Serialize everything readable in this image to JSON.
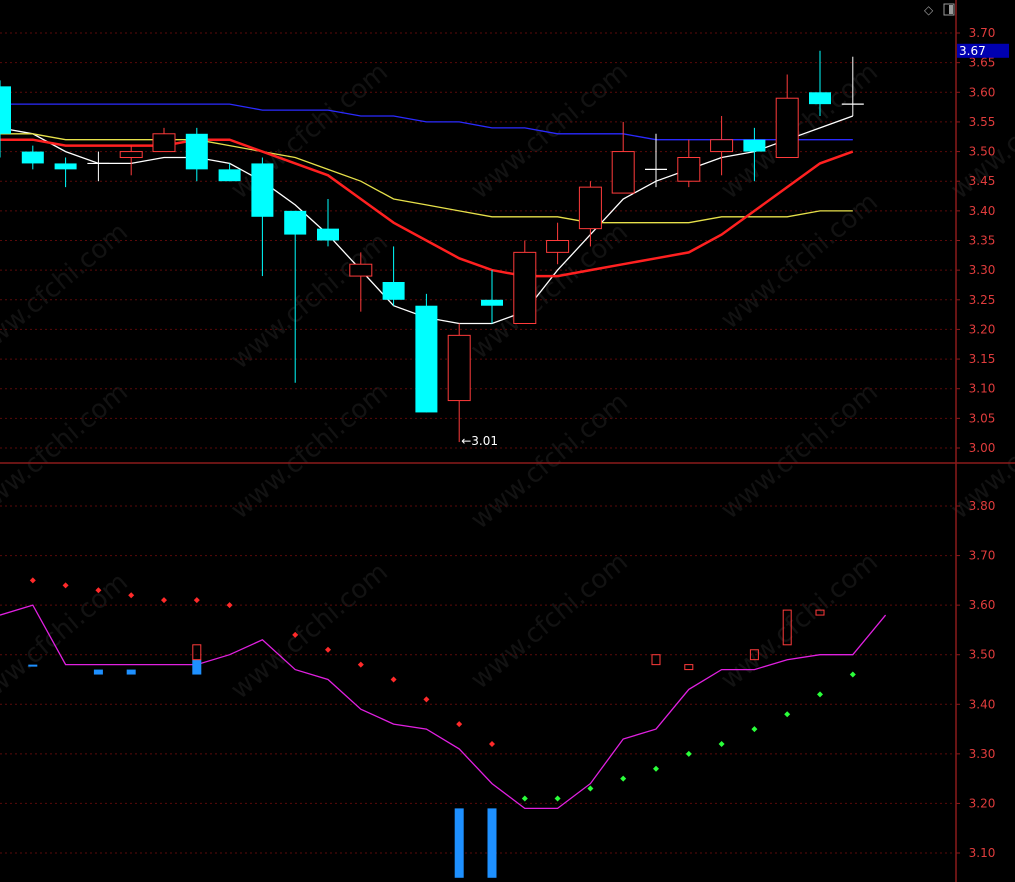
{
  "toolbar": {
    "diamond_icon": "diamond-icon",
    "panel_icon": "panel-toggle-icon"
  },
  "watermark": "www.cfchi.com",
  "colors": {
    "bg": "#000000",
    "grid": "#5a0a0a",
    "axis": "#8a1a1a",
    "tick": "#e03c3c",
    "up": "#ff3b3b",
    "down": "#00ffff",
    "doji": "#ffffff",
    "ma_white": "#ffffff",
    "ma_yellow": "#e6e04a",
    "ma_red": "#ff2020",
    "ma_blue": "#2a2aff",
    "sar_red": "#ff2a2a",
    "sar_green": "#2aff3a",
    "mid_line": "#e020e0",
    "vol_blue": "#1e90ff",
    "box_red": "#ff3b3b",
    "last_box_bg": "#0000b0"
  },
  "chart_data": [
    {
      "type": "candlestick",
      "panel": "price",
      "ylim": [
        2.97,
        3.72
      ],
      "y_ticks": [
        "3.70",
        "3.65",
        "3.60",
        "3.55",
        "3.50",
        "3.45",
        "3.40",
        "3.35",
        "3.30",
        "3.25",
        "3.20",
        "3.15",
        "3.10",
        "3.05",
        "3.00"
      ],
      "last_price_label": "3.67",
      "low_annotation": "3.01",
      "candles": [
        {
          "o": 3.61,
          "h": 3.62,
          "l": 3.49,
          "c": 3.53
        },
        {
          "o": 3.5,
          "h": 3.51,
          "l": 3.47,
          "c": 3.48
        },
        {
          "o": 3.48,
          "h": 3.49,
          "l": 3.44,
          "c": 3.47
        },
        {
          "o": 3.48,
          "h": 3.5,
          "l": 3.45,
          "c": 3.48
        },
        {
          "o": 3.49,
          "h": 3.51,
          "l": 3.46,
          "c": 3.5
        },
        {
          "o": 3.5,
          "h": 3.54,
          "l": 3.5,
          "c": 3.53
        },
        {
          "o": 3.53,
          "h": 3.54,
          "l": 3.45,
          "c": 3.47
        },
        {
          "o": 3.47,
          "h": 3.48,
          "l": 3.45,
          "c": 3.45
        },
        {
          "o": 3.48,
          "h": 3.49,
          "l": 3.29,
          "c": 3.39
        },
        {
          "o": 3.4,
          "h": 3.4,
          "l": 3.11,
          "c": 3.36
        },
        {
          "o": 3.37,
          "h": 3.42,
          "l": 3.34,
          "c": 3.35
        },
        {
          "o": 3.29,
          "h": 3.33,
          "l": 3.23,
          "c": 3.31
        },
        {
          "o": 3.28,
          "h": 3.34,
          "l": 3.24,
          "c": 3.25
        },
        {
          "o": 3.24,
          "h": 3.26,
          "l": 3.06,
          "c": 3.06
        },
        {
          "o": 3.08,
          "h": 3.21,
          "l": 3.01,
          "c": 3.19
        },
        {
          "o": 3.25,
          "h": 3.3,
          "l": 3.21,
          "c": 3.24
        },
        {
          "o": 3.21,
          "h": 3.35,
          "l": 3.21,
          "c": 3.33
        },
        {
          "o": 3.33,
          "h": 3.38,
          "l": 3.31,
          "c": 3.35
        },
        {
          "o": 3.37,
          "h": 3.45,
          "l": 3.34,
          "c": 3.44
        },
        {
          "o": 3.43,
          "h": 3.55,
          "l": 3.43,
          "c": 3.5
        },
        {
          "o": 3.47,
          "h": 3.53,
          "l": 3.44,
          "c": 3.47
        },
        {
          "o": 3.45,
          "h": 3.52,
          "l": 3.44,
          "c": 3.49
        },
        {
          "o": 3.5,
          "h": 3.56,
          "l": 3.46,
          "c": 3.52
        },
        {
          "o": 3.52,
          "h": 3.54,
          "l": 3.45,
          "c": 3.5
        },
        {
          "o": 3.49,
          "h": 3.63,
          "l": 3.49,
          "c": 3.59
        },
        {
          "o": 3.6,
          "h": 3.67,
          "l": 3.56,
          "c": 3.58
        },
        {
          "o": 3.58,
          "h": 3.66,
          "l": 3.56,
          "c": 3.58
        }
      ],
      "series": [
        {
          "color_key": "ma_white",
          "values": [
            3.54,
            3.53,
            3.5,
            3.48,
            3.48,
            3.49,
            3.49,
            3.48,
            3.45,
            3.41,
            3.36,
            3.3,
            3.24,
            3.22,
            3.21,
            3.21,
            3.23,
            3.3,
            3.36,
            3.42,
            3.45,
            3.47,
            3.49,
            3.5,
            3.52,
            3.54,
            3.56
          ]
        },
        {
          "color_key": "ma_yellow",
          "values": [
            3.53,
            3.53,
            3.52,
            3.52,
            3.52,
            3.52,
            3.52,
            3.51,
            3.5,
            3.49,
            3.47,
            3.45,
            3.42,
            3.41,
            3.4,
            3.39,
            3.39,
            3.39,
            3.38,
            3.38,
            3.38,
            3.38,
            3.39,
            3.39,
            3.39,
            3.4,
            3.4
          ]
        },
        {
          "color_key": "ma_red",
          "values": [
            3.52,
            3.52,
            3.51,
            3.51,
            3.51,
            3.51,
            3.52,
            3.52,
            3.5,
            3.48,
            3.46,
            3.42,
            3.38,
            3.35,
            3.32,
            3.3,
            3.29,
            3.29,
            3.3,
            3.31,
            3.32,
            3.33,
            3.36,
            3.4,
            3.44,
            3.48,
            3.5
          ]
        },
        {
          "color_key": "ma_blue",
          "values": [
            3.58,
            3.58,
            3.58,
            3.58,
            3.58,
            3.58,
            3.58,
            3.58,
            3.57,
            3.57,
            3.57,
            3.56,
            3.56,
            3.55,
            3.55,
            3.54,
            3.54,
            3.53,
            3.53,
            3.53,
            3.52,
            3.52,
            3.52,
            3.52,
            3.52,
            3.52,
            3.52
          ]
        }
      ]
    },
    {
      "type": "indicator",
      "panel": "lower",
      "ylim": [
        3.07,
        3.88
      ],
      "y_ticks": [
        "3.80",
        "3.70",
        "3.60",
        "3.50",
        "3.40",
        "3.30",
        "3.20",
        "3.10"
      ],
      "mid_line": [
        3.58,
        3.6,
        3.48,
        3.48,
        3.48,
        3.48,
        3.48,
        3.5,
        3.53,
        3.47,
        3.45,
        3.39,
        3.36,
        3.35,
        3.31,
        3.24,
        3.19,
        3.19,
        3.24,
        3.33,
        3.35,
        3.43,
        3.47,
        3.47,
        3.49,
        3.5,
        3.5,
        3.58
      ],
      "sar_red": [
        {
          "i": 1,
          "v": 3.65
        },
        {
          "i": 2,
          "v": 3.64
        },
        {
          "i": 3,
          "v": 3.63
        },
        {
          "i": 4,
          "v": 3.62
        },
        {
          "i": 5,
          "v": 3.61
        },
        {
          "i": 6,
          "v": 3.61
        },
        {
          "i": 7,
          "v": 3.6
        },
        {
          "i": 9,
          "v": 3.54
        },
        {
          "i": 10,
          "v": 3.51
        },
        {
          "i": 11,
          "v": 3.48
        },
        {
          "i": 12,
          "v": 3.45
        },
        {
          "i": 13,
          "v": 3.41
        },
        {
          "i": 14,
          "v": 3.36
        },
        {
          "i": 15,
          "v": 3.32
        }
      ],
      "sar_green": [
        {
          "i": 16,
          "v": 3.21
        },
        {
          "i": 17,
          "v": 3.21
        },
        {
          "i": 18,
          "v": 3.23
        },
        {
          "i": 19,
          "v": 3.25
        },
        {
          "i": 20,
          "v": 3.27
        },
        {
          "i": 21,
          "v": 3.3
        },
        {
          "i": 22,
          "v": 3.32
        },
        {
          "i": 23,
          "v": 3.35
        },
        {
          "i": 24,
          "v": 3.38
        },
        {
          "i": 25,
          "v": 3.42
        },
        {
          "i": 26,
          "v": 3.46
        }
      ],
      "blue_bars": [
        {
          "i": 1,
          "top": 3.48,
          "bottom": 3.48
        },
        {
          "i": 3,
          "top": 3.47,
          "bottom": 3.46
        },
        {
          "i": 4,
          "top": 3.47,
          "bottom": 3.46
        },
        {
          "i": 6,
          "top": 3.49,
          "bottom": 3.46
        },
        {
          "i": 14,
          "top": 3.19,
          "bottom": 3.05
        },
        {
          "i": 15,
          "top": 3.19,
          "bottom": 3.05
        }
      ],
      "red_boxes": [
        {
          "i": 6,
          "top": 3.52,
          "bottom": 3.49
        },
        {
          "i": 20,
          "top": 3.5,
          "bottom": 3.48
        },
        {
          "i": 21,
          "top": 3.48,
          "bottom": 3.47
        },
        {
          "i": 23,
          "top": 3.51,
          "bottom": 3.49
        },
        {
          "i": 24,
          "top": 3.59,
          "bottom": 3.52
        },
        {
          "i": 25,
          "top": 3.59,
          "bottom": 3.58
        }
      ]
    }
  ]
}
